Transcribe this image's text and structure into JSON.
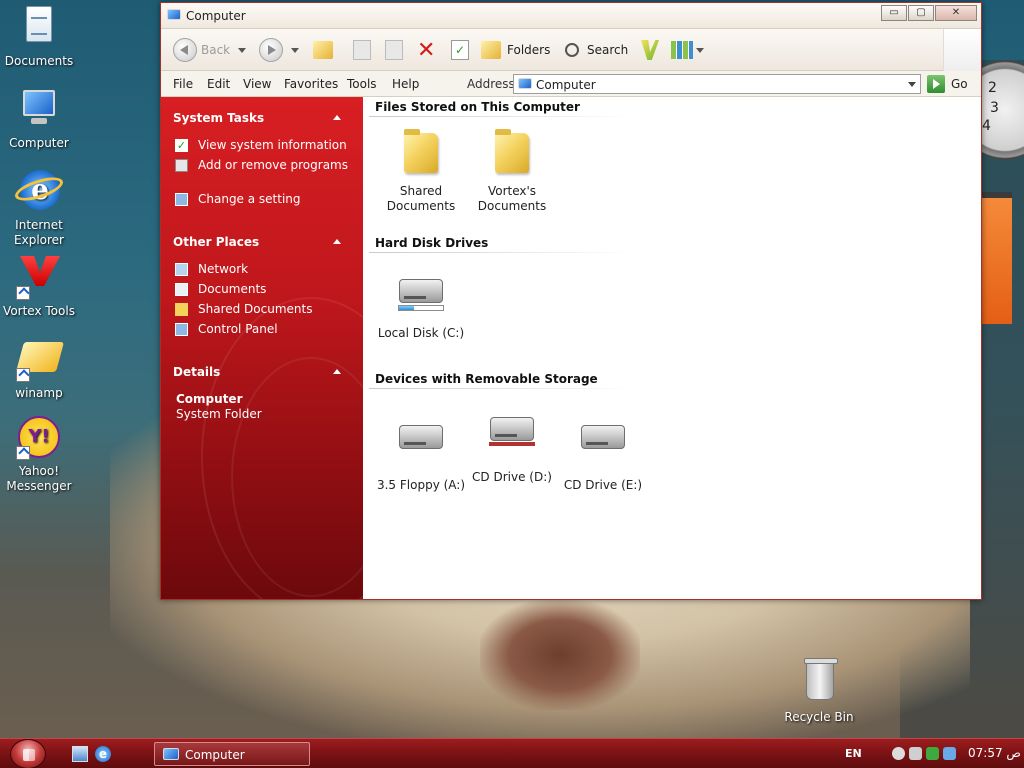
{
  "desktop": {
    "icons": [
      {
        "label": "Documents",
        "icon": "documents-icon"
      },
      {
        "label": "Computer",
        "icon": "computer-icon"
      },
      {
        "label": "Internet Explorer",
        "icon": "internet-explorer-icon"
      },
      {
        "label": "Vortex Tools",
        "icon": "vortex-tools-icon"
      },
      {
        "label": "winamp",
        "icon": "winamp-icon"
      },
      {
        "label": "Yahoo! Messenger",
        "icon": "yahoo-messenger-icon"
      },
      {
        "label": "Recycle Bin",
        "icon": "recycle-bin-icon"
      }
    ],
    "clock_gadget": {
      "n2": "2",
      "n3": "3",
      "n4": "4"
    }
  },
  "window": {
    "title": "Computer",
    "controls": {
      "minimize": "▭",
      "maximize": "▢",
      "close": "✕"
    },
    "toolbar": {
      "back_label": "Back",
      "folders_label": "Folders",
      "search_label": "Search"
    },
    "menu": [
      "File",
      "Edit",
      "View",
      "Favorites",
      "Tools",
      "Help"
    ],
    "address": {
      "label": "Address",
      "value": "Computer",
      "go_label": "Go"
    },
    "left_pane": {
      "system_tasks": {
        "title": "System Tasks",
        "items": [
          "View system information",
          "Add or remove programs",
          "Change a setting"
        ]
      },
      "other_places": {
        "title": "Other Places",
        "items": [
          "Network",
          "Documents",
          "Shared Documents",
          "Control Panel"
        ]
      },
      "details": {
        "title": "Details",
        "name": "Computer",
        "type": "System Folder"
      }
    },
    "groups": {
      "files_stored": {
        "title": "Files Stored on This Computer",
        "items": [
          "Shared Documents",
          "Vortex's Documents"
        ]
      },
      "hard_disks": {
        "title": "Hard Disk Drives",
        "items": [
          {
            "label": "Local Disk (C:)",
            "usage_fraction": 0.35
          }
        ]
      },
      "removable": {
        "title": "Devices with Removable Storage",
        "items": [
          "3.5 Floppy (A:)",
          "CD Drive (D:)",
          "CD Drive (E:)"
        ]
      }
    }
  },
  "taskbar": {
    "task_button": "Computer",
    "language": "EN",
    "clock": "07:57 ص"
  },
  "colors": {
    "accent_red": "#c8181d",
    "taskbar": "#7b1214",
    "window_bg": "#f3efe9"
  }
}
